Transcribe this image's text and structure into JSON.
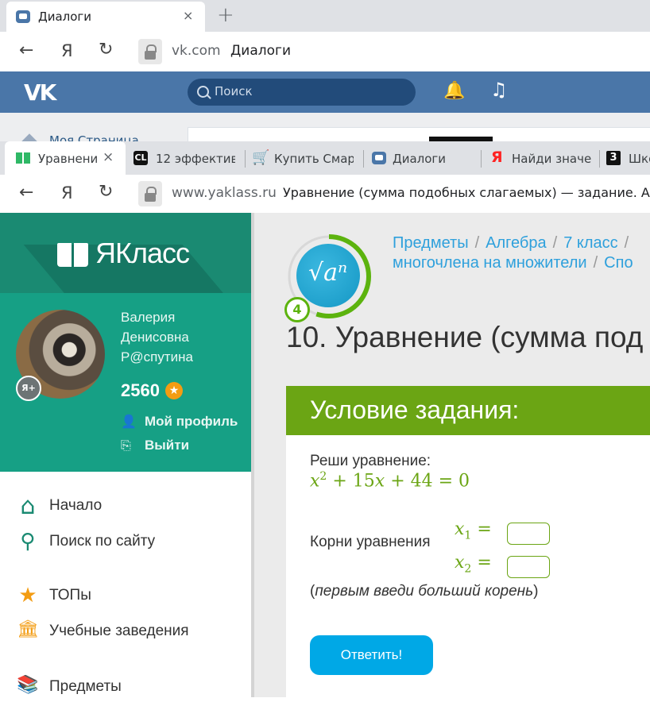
{
  "window_back": {
    "tab": {
      "title": "Диалоги",
      "close": "×"
    },
    "new_tab": "+",
    "address": {
      "domain": "vk.com",
      "title": "Диалоги"
    },
    "nav": {
      "back": "←",
      "yandex": "Я",
      "reload": "↻"
    },
    "vk": {
      "logo": "VK",
      "search_placeholder": "Поиск",
      "bell": "🔔",
      "music": "♫",
      "my_page": "Моя Страница"
    }
  },
  "window_front": {
    "tabs": [
      {
        "title": "Уравнение",
        "close": "×"
      },
      {
        "title": "12 эффектив"
      },
      {
        "title": "Купить Смар"
      },
      {
        "title": "Диалоги"
      },
      {
        "title": "Найди значе"
      },
      {
        "title": "Шко"
      }
    ],
    "favicons": {
      "cl": "CL",
      "cart": "🛒",
      "ya": "Я",
      "three": "3"
    },
    "nav": {
      "back": "←",
      "yandex": "Я",
      "reload": "↻"
    },
    "address": {
      "domain": "www.yaklass.ru",
      "title": "Уравнение (сумма подобных слагаемых) — задание. А"
    }
  },
  "yaklass": {
    "logo": "ЯКласс",
    "user": {
      "first_name": "Валерия",
      "middle_name": "Денисовна",
      "last_name": "Р@спутина",
      "badge": "Я+",
      "points": "2560",
      "star": "★"
    },
    "profile_links": [
      {
        "label": "Мой профиль",
        "icon": "👤"
      },
      {
        "label": "Выйти",
        "icon": "⎘"
      }
    ],
    "menu": [
      {
        "label": "Начало",
        "icon": "⌂"
      },
      {
        "label": "Поиск по сайту",
        "icon": "⚲"
      },
      {
        "label": "ТОПы",
        "icon": "★"
      },
      {
        "label": "Учебные заведения",
        "icon": "🏛"
      },
      {
        "label": "Предметы",
        "icon": "📚"
      }
    ],
    "topic": {
      "formula": "√aⁿ",
      "level": "4",
      "progress": 0.55
    },
    "breadcrumbs": {
      "line1": [
        "Предметы",
        "Алгебра",
        "7 класс",
        ""
      ],
      "line2": [
        "многочлена на множители",
        "Спо"
      ]
    },
    "task_title": "10. Уравнение (сумма под",
    "condition": {
      "header": "Условие задания:",
      "instruction": "Реши уравнение:",
      "equation": {
        "x": "x",
        "pow": "2",
        "rest": "+ 15",
        "x2": "x",
        "tail": "+ 44 = 0"
      },
      "roots_label": "Корни уравнения",
      "root1": {
        "var": "x",
        "sub": "1",
        "eq": "="
      },
      "root2": {
        "var": "x",
        "sub": "2",
        "eq": "="
      },
      "hint_open": "(",
      "hint": "первым введи больший корень",
      "hint_close": ")",
      "root1_value": "",
      "root2_value": "",
      "submit": "Ответить!"
    }
  }
}
